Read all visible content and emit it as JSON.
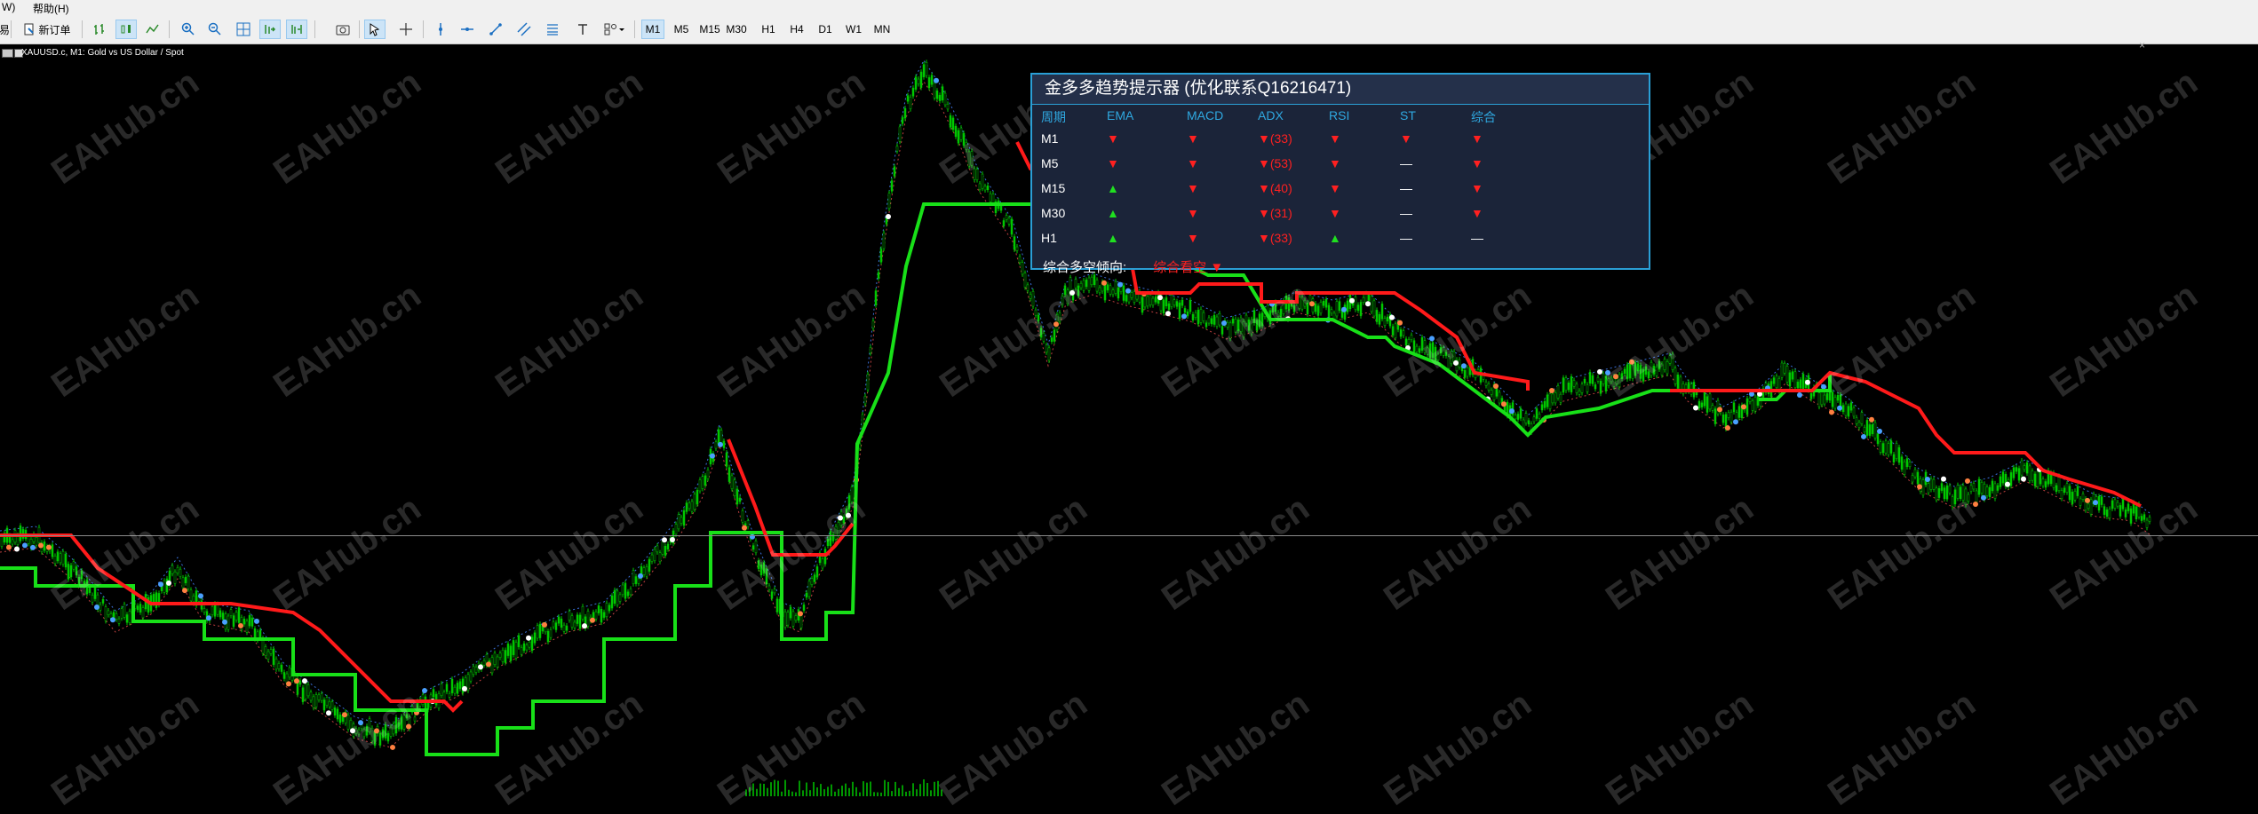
{
  "menu": {
    "item_left": "W)",
    "help": "帮助(H)"
  },
  "toolbar": {
    "partial_left": "易",
    "new_order": "新订单",
    "timeframes": [
      "M1",
      "M5",
      "M15",
      "M30",
      "H1",
      "H4",
      "D1",
      "W1",
      "MN"
    ],
    "active_timeframe": "M1"
  },
  "chart": {
    "symbol_caption": "XAUUSD.c, M1:  Gold vs US Dollar / Spot",
    "watermark": "EAHub.cn",
    "background": "#000000",
    "bull_color": "#00c800",
    "stop_up_color": "#18e018",
    "stop_down_color": "#ff1a1a"
  },
  "panel": {
    "title": "金多多趋势提示器 (优化联系Q16216471)",
    "headers": [
      "周期",
      "EMA",
      "MACD",
      "ADX",
      "RSI",
      "ST",
      "综合"
    ],
    "rows": [
      {
        "period": "M1",
        "ema": "▼",
        "macd": "▼",
        "adx": "▼(33)",
        "rsi": "▼",
        "st": "▼",
        "total": "▼"
      },
      {
        "period": "M5",
        "ema": "▼",
        "macd": "▼",
        "adx": "▼(53)",
        "rsi": "▼",
        "st": "—",
        "total": "▼"
      },
      {
        "period": "M15",
        "ema": "▲",
        "macd": "▼",
        "adx": "▼(40)",
        "rsi": "▼",
        "st": "—",
        "total": "▼"
      },
      {
        "period": "M30",
        "ema": "▲",
        "macd": "▼",
        "adx": "▼(31)",
        "rsi": "▼",
        "st": "—",
        "total": "▼"
      },
      {
        "period": "H1",
        "ema": "▲",
        "macd": "▼",
        "adx": "▼(33)",
        "rsi": "▲",
        "st": "—",
        "total": "—"
      }
    ],
    "summary_label": "综合多空倾向:",
    "summary_value": "综合看空 ▼",
    "border_color": "#2a9fd6",
    "up_color": "#20e020",
    "down_color": "#ff2020"
  }
}
